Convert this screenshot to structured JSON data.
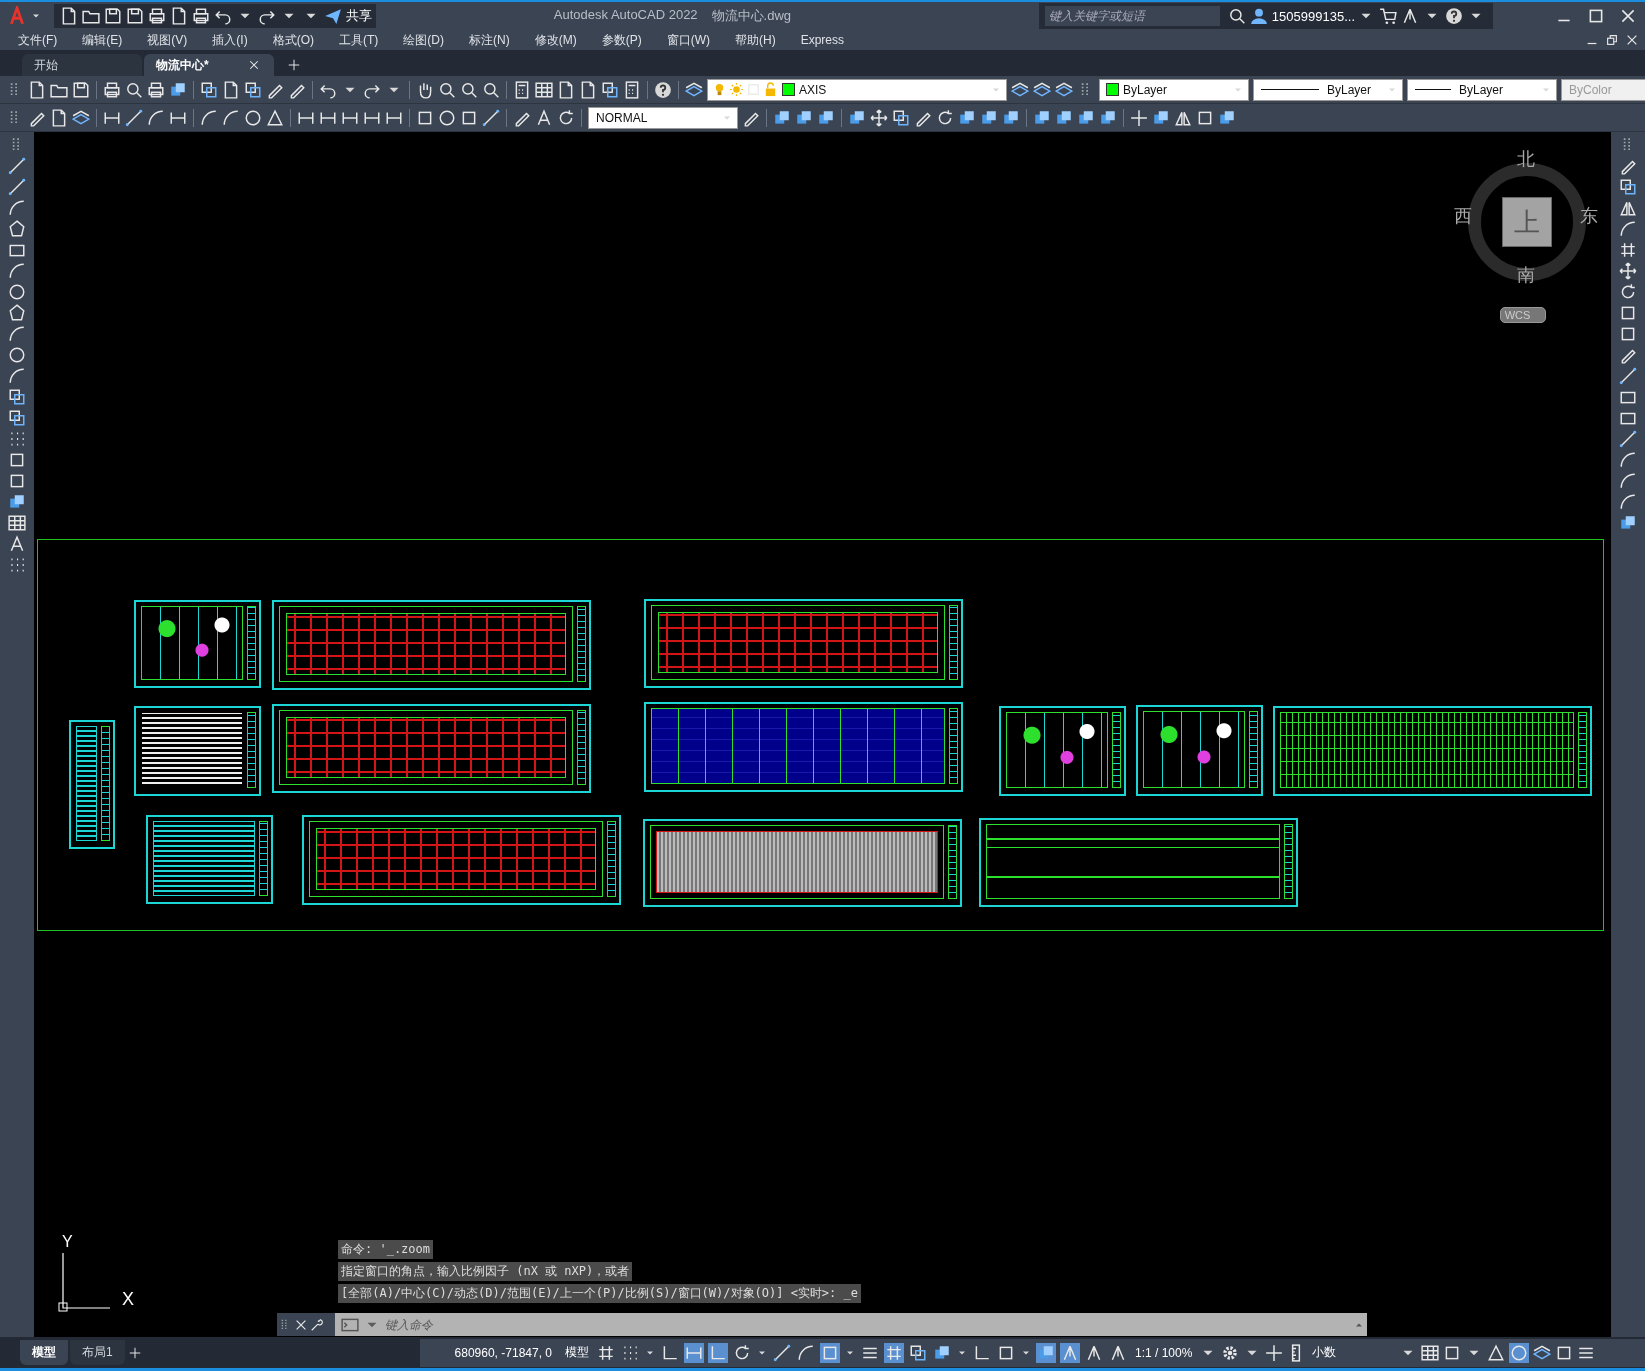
{
  "title_bar": {
    "share": "共享",
    "app_title": "Autodesk AutoCAD 2022",
    "file_name": "物流中心.dwg",
    "search": {
      "placeholder": "键入关键字或短语"
    },
    "user": "1505999135..."
  },
  "menu": [
    "文件(F)",
    "编辑(E)",
    "视图(V)",
    "插入(I)",
    "格式(O)",
    "工具(T)",
    "绘图(D)",
    "标注(N)",
    "修改(M)",
    "参数(P)",
    "窗口(W)",
    "帮助(H)",
    "Express"
  ],
  "doc_tabs": [
    {
      "label": "开始",
      "selected": false
    },
    {
      "label": "物流中心*",
      "selected": true
    }
  ],
  "properties_bar": {
    "layer": "AXIS",
    "color_setting": "ByLayer",
    "linetype": "ByLayer",
    "lineweight": "ByLayer",
    "plot_style": {
      "value": "ByColor",
      "disabled": true
    },
    "text_style": "NORMAL"
  },
  "viewcube": {
    "north": "北",
    "south": "南",
    "east": "东",
    "west": "西",
    "face": "上",
    "coordinate_system": "WCS"
  },
  "ucs": {
    "x": "X",
    "y": "Y"
  },
  "command_history": [
    "命令: '_.zoom",
    "指定窗口的角点，输入比例因子 (nX 或 nXP)，或者",
    "[全部(A)/中心(C)/动态(D)/范围(E)/上一个(P)/比例(S)/窗口(W)/对象(O)] <实时>: _e"
  ],
  "command_line": {
    "placeholder": "键入命令"
  },
  "layout_tabs": [
    {
      "label": "模型",
      "selected": true
    },
    {
      "label": "布局1",
      "selected": false
    }
  ],
  "status_bar": {
    "coordinates": "680960, -71847, 0",
    "space": "模型",
    "toggles": [
      {
        "kind": "grid",
        "on": false
      },
      {
        "kind": "dots",
        "on": false
      },
      {
        "kind": "infer",
        "on": false
      },
      {
        "kind": "snap",
        "on": true
      },
      {
        "kind": "ortho",
        "on": true
      },
      {
        "kind": "polar",
        "on": false
      },
      {
        "kind": "iso",
        "on": false
      },
      {
        "kind": "track",
        "on": false
      },
      {
        "kind": "osnap",
        "on": true
      },
      {
        "kind": "lineweight",
        "on": false
      },
      {
        "kind": "transparency",
        "on": true
      },
      {
        "kind": "cycle",
        "on": false
      },
      {
        "kind": "cube",
        "on": false
      },
      {
        "kind": "ucs",
        "on": false
      },
      {
        "kind": "gizmo",
        "on": false
      },
      {
        "kind": "gizmo3d",
        "on": true
      },
      {
        "kind": "annotate",
        "on": true
      },
      {
        "kind": "annoauto",
        "on": false
      },
      {
        "kind": "annoscale",
        "on": false
      }
    ],
    "scale": "1:1 / 100%",
    "units": "小数",
    "accel_on": true
  }
}
